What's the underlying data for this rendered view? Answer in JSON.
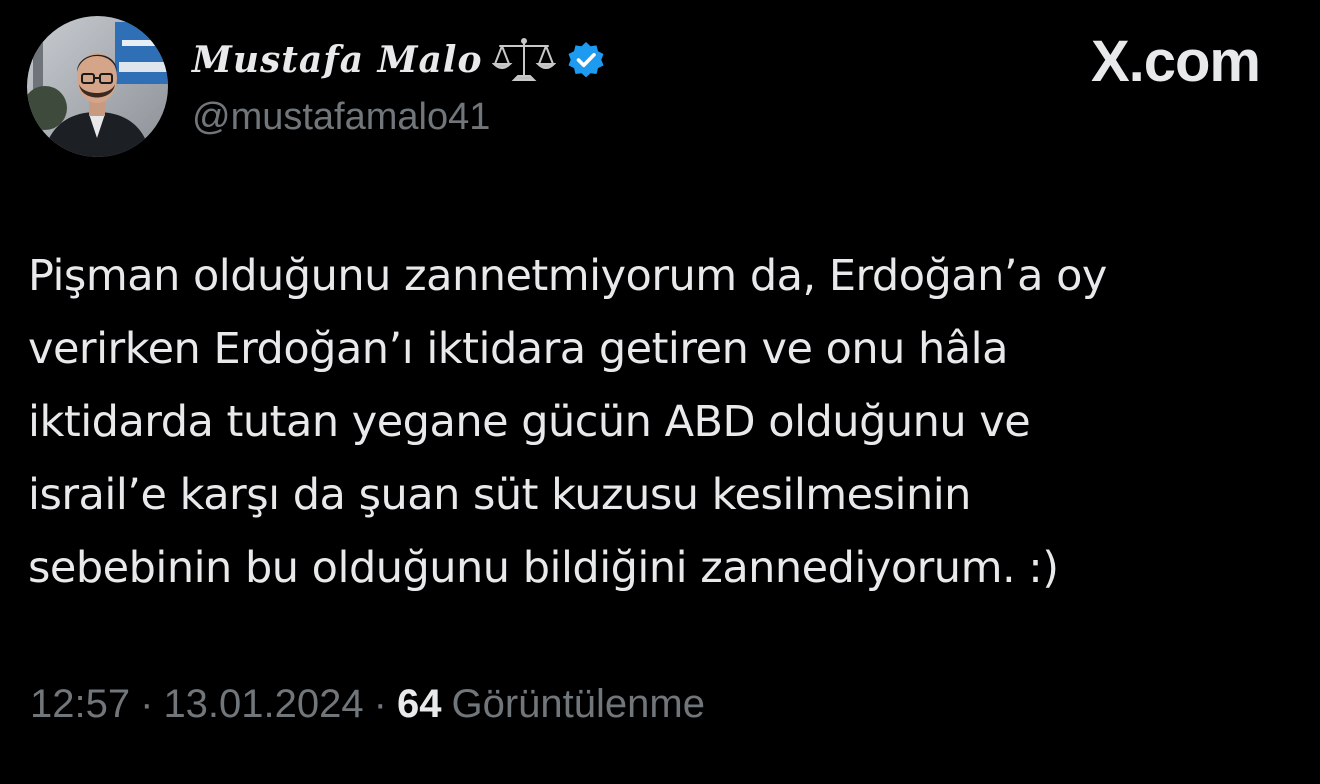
{
  "author": {
    "display_name": "Mustafa Malo",
    "handle": "@mustafamalo41",
    "badge_icon": "scales-of-justice-icon",
    "verified_icon": "verified-badge-icon",
    "verified_color": "#1d9bf0"
  },
  "brand": {
    "site": "X.com"
  },
  "tweet": {
    "lines": [
      "Pişman olduğunu zannetmiyorum da, Erdoğan’a oy",
      "verirken Erdoğan’ı iktidara getiren ve onu hâla",
      "iktidarda tutan yegane gücün ABD olduğunu ve",
      "israil’e karşı da şuan süt kuzusu kesilmesinin",
      "sebebinin bu olduğunu bildiğini zannediyorum. :)"
    ]
  },
  "meta": {
    "time": "12:57",
    "separator_1": "·",
    "date": "13.01.2024",
    "separator_2": "·",
    "views_count": "64",
    "views_label": "Görüntülenme"
  },
  "colors": {
    "background": "#000000",
    "text_primary": "#e7e9ea",
    "text_secondary": "#71767b",
    "accent": "#1d9bf0"
  }
}
